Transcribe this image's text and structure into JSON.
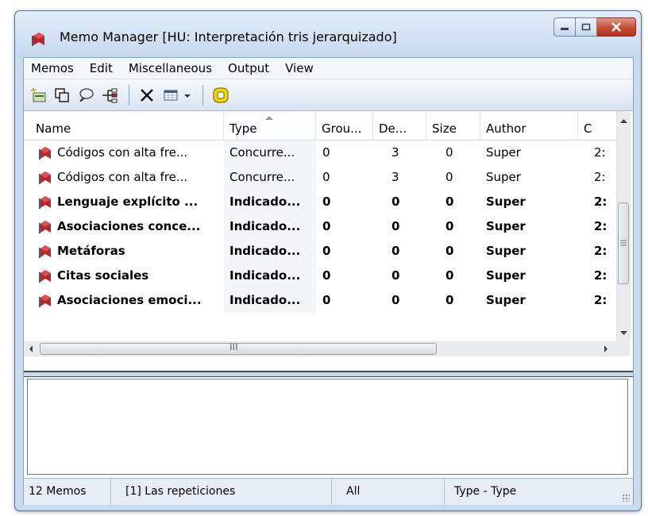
{
  "window": {
    "title": "Memo Manager [HU: Interpretación tris jerarquizado]"
  },
  "menu": [
    "Memos",
    "Edit",
    "Miscellaneous",
    "Output",
    "View"
  ],
  "toolbar": {
    "icons": [
      "new-memo-icon",
      "duplicate-icon",
      "comment-icon",
      "tree-icon",
      "delete-icon",
      "grid-view-icon",
      "dropdown-arrow-icon",
      "highlight-icon"
    ]
  },
  "columns": [
    "Name",
    "Type",
    "Grou...",
    "De...",
    "Size",
    "Author",
    "C"
  ],
  "rows": [
    {
      "name": "Códigos con alta fre...",
      "type": "Concurre...",
      "groups": "0",
      "de": "3",
      "size": "0",
      "author": "Super",
      "c": "2:",
      "bold": false
    },
    {
      "name": "Códigos con alta fre...",
      "type": "Concurre...",
      "groups": "0",
      "de": "3",
      "size": "0",
      "author": "Super",
      "c": "2:",
      "bold": false
    },
    {
      "name": "Lenguaje explícito ...",
      "type": "Indicado...",
      "groups": "0",
      "de": "0",
      "size": "0",
      "author": "Super",
      "c": "2:",
      "bold": true
    },
    {
      "name": "Asociaciones conce...",
      "type": "Indicado...",
      "groups": "0",
      "de": "0",
      "size": "0",
      "author": "Super",
      "c": "2:",
      "bold": true
    },
    {
      "name": "Metáforas",
      "type": "Indicado...",
      "groups": "0",
      "de": "0",
      "size": "0",
      "author": "Super",
      "c": "2:",
      "bold": true
    },
    {
      "name": "Citas sociales",
      "type": "Indicado...",
      "groups": "0",
      "de": "0",
      "size": "0",
      "author": "Super",
      "c": "2:",
      "bold": true
    },
    {
      "name": "Asociaciones emoci...",
      "type": "Indicado...",
      "groups": "0",
      "de": "0",
      "size": "0",
      "author": "Super",
      "c": "2:",
      "bold": true
    }
  ],
  "hscroll_label": "III",
  "status": {
    "count": "12 Memos",
    "current": "[1] Las repeticiones",
    "filter": "All",
    "sort": "Type - Type"
  },
  "colors": {
    "memo_icon": "#b7252f",
    "highlight_icon": "#f4d600"
  }
}
